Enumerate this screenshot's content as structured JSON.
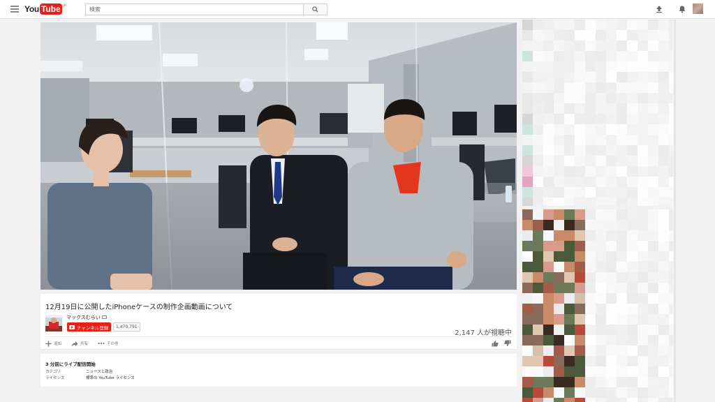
{
  "masthead": {
    "logo_you": "You",
    "logo_tube": "Tube",
    "logo_region": "JP",
    "search_placeholder": "検索"
  },
  "icons": {
    "menu": "hamburger-icon",
    "search": "search-icon",
    "upload": "upload-icon",
    "notifications": "bell-icon",
    "add": "plus-icon",
    "share": "share-arrow-icon",
    "more": "more-dots-icon",
    "like": "thumbs-up-icon",
    "dislike": "thumbs-down-icon"
  },
  "colors": {
    "brand_red": "#e62117",
    "page_bg": "#f1f1f1",
    "card_bg": "#ffffff"
  },
  "video": {
    "title": "12月19日に公開したiPhoneケースの制作企画動画について",
    "channel_name": "マックスむらい",
    "subscribe_label": "チャンネル登録",
    "subscriber_count": "1,470,791",
    "viewers": "2,147 人が視聴中",
    "actions": {
      "add": "追加",
      "share": "共有",
      "more": "その他"
    }
  },
  "description": {
    "started": "3 分前にライブ配信開始",
    "category_label": "カテゴリ",
    "category_value": "ニュースと政治",
    "license_label": "ライセンス",
    "license_value": "標準の YouTube ライセンス"
  }
}
